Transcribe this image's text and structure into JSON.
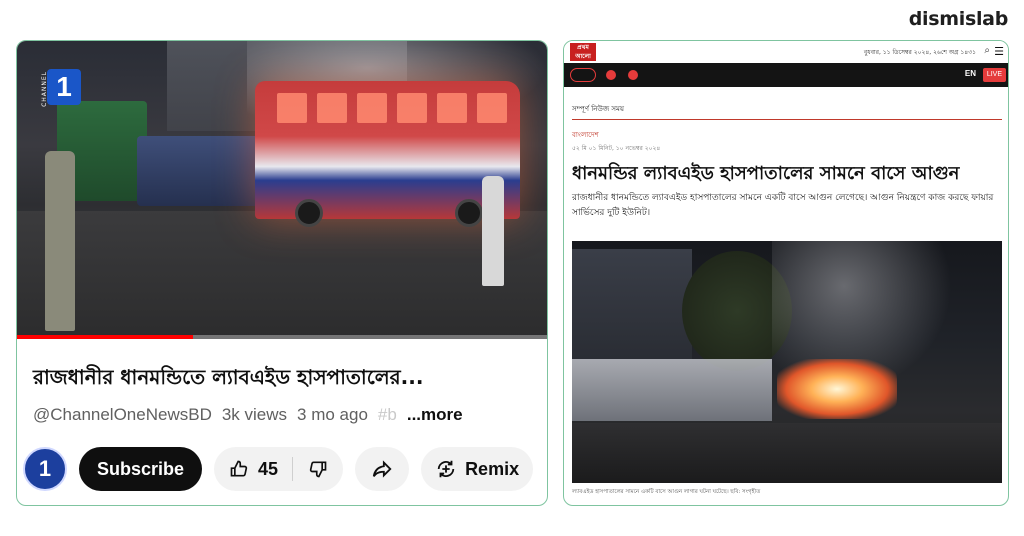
{
  "brand": {
    "name": "dismislab"
  },
  "youtube": {
    "channel_logo_digit": "1",
    "channel_logo_text": "CHANNEL",
    "progress_fraction": 0.33,
    "title": "রাজধানীর ধানমন্ডিতে ল্যাবএইড হাসপাতালের...",
    "channel_handle": "@ChannelOneNewsBD",
    "views": "3k views",
    "age": "3 mo ago",
    "tag_fragment": "#b",
    "more_label": "...more",
    "avatar_text": "1",
    "subscribe_label": "Subscribe",
    "likes": "45",
    "remix_label": "Remix",
    "icons": [
      "thumbs-up-icon",
      "thumbs-down-icon",
      "share-icon",
      "remix-icon"
    ]
  },
  "newspaper": {
    "logo_text": "প্রথম আলো",
    "date_top": "বুধবার, ১১ ডিসেম্বর ২০২৪, ২৬শে অগ্র ১৪৩১",
    "lang_label": "EN",
    "live_label": "LIVE",
    "crumb": "সম্পূর্ণ নিউজ সময়",
    "section": "বাংলাদেশ",
    "dateline": "৫২ মি ০১ মিনিট, ১০ নভেম্বর ২০২৪",
    "headline": "ধানমন্ডির ল্যাবএইড হাসপাতালের সামনে বাসে আগুন",
    "lead": "রাজধানীর ধানমন্ডিতে ল্যাবএইড হাসপাতালের সামনে একটি বাসে আগুন লেগেছে। আগুন নিয়ন্ত্রণে কাজ করছে ফায়ার সার্ভিসের দুটি ইউনিট।",
    "caption": "ল্যাবএইড হাসপাতালের সামনে একটি বাসে আগুন লাগার ঘটনা ঘটেছে। ছবি: সংগৃহীত"
  }
}
